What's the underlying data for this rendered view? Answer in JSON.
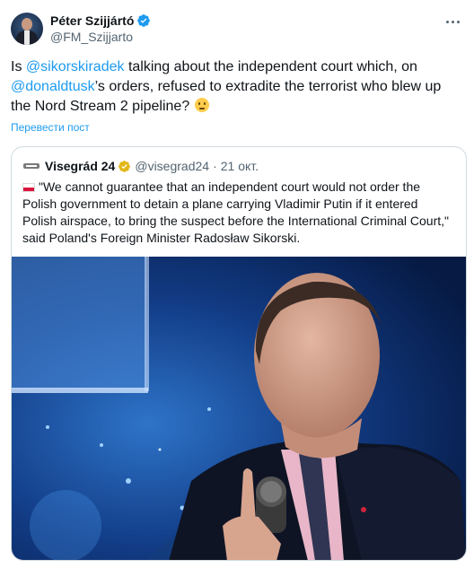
{
  "author": {
    "name": "Péter Szijjártó",
    "handle": "@FM_Szijjarto",
    "avatar_icon": "profile-photo",
    "verified_icon": "verified-badge-icon"
  },
  "tweet": {
    "text_parts": [
      "Is ",
      "@sikorskiradek",
      " talking about the independent court which, on ",
      "@donaldtusk",
      "’s orders, refused to extradite the terrorist who blew up the Nord Stream 2 pipeline? ",
      "🤔"
    ],
    "translate_link": "Перевести пост"
  },
  "quoted_tweet": {
    "name": "Visegrád 24",
    "handle": "@visegrad24",
    "separator": "·",
    "date": "21 окт.",
    "badge_icon": "gold-verified-badge-icon",
    "flag_icon": "poland-flag-icon",
    "text": "\"We cannot guarantee that an independent court would not order the Polish government to detain a plane carrying Vladimir Putin if it entered Polish airspace, to bring the suspect before the International Criminal Court,\" said Poland's Foreign Minister Radosław Sikorski.",
    "image_icon": "photo-man-with-microphone"
  },
  "colors": {
    "link": "#1d9bf0",
    "verified_blue": "#1d9bf0",
    "verified_gold": "#e2b719",
    "secondary_text": "#536471",
    "border": "#cfd9de"
  }
}
